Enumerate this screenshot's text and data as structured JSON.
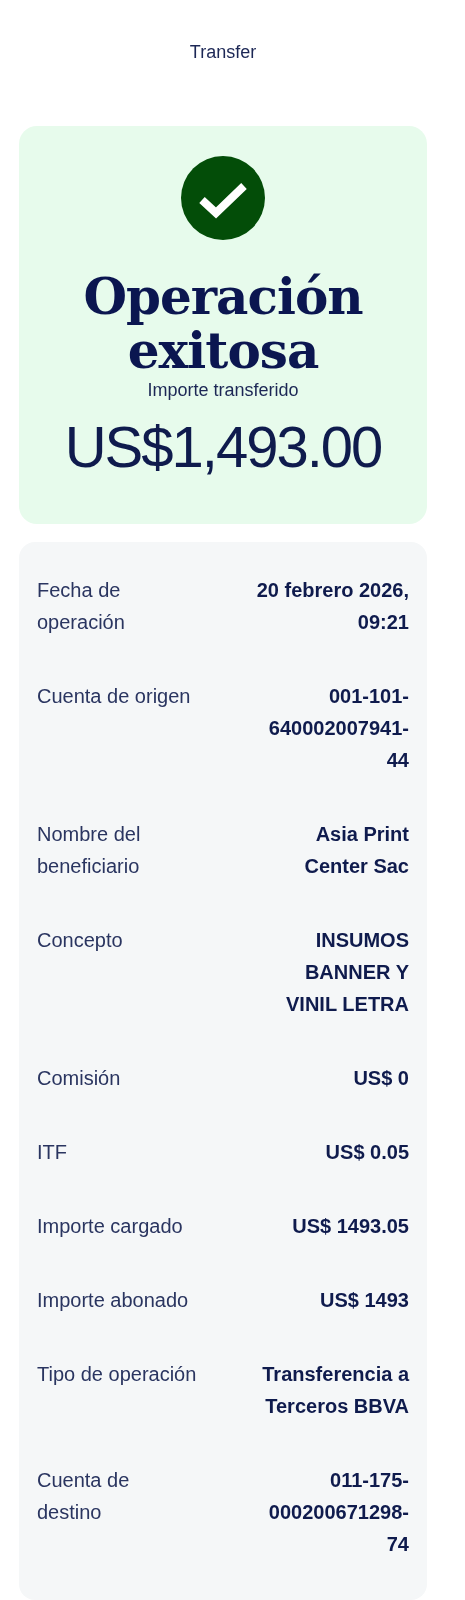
{
  "header": {
    "title": "Transfer"
  },
  "result": {
    "succeeded": true,
    "heading": "Operación exitosa",
    "amount_label": "Importe transferido",
    "amount": "US$1,493.00"
  },
  "details": [
    {
      "label": "Fecha de operación",
      "value": "20 febrero 2026, 09:21"
    },
    {
      "label": "Cuenta de origen",
      "value": "001-101-640002007941-44"
    },
    {
      "label": "Nombre del beneficiario",
      "value": "Asia Print Center Sac"
    },
    {
      "label": "Concepto",
      "value": "INSUMOS BANNER Y VINIL LETRA"
    },
    {
      "label": "Comisión",
      "value": "US$ 0"
    },
    {
      "label": "ITF",
      "value": "US$ 0.05"
    },
    {
      "label": "Importe cargado",
      "value": "US$ 1493.05"
    },
    {
      "label": "Importe abonado",
      "value": "US$ 1493"
    },
    {
      "label": "Tipo de operación",
      "value": "Transferencia a Terceros BBVA"
    },
    {
      "label": "Cuenta de destino",
      "value": "011-175-000200671298-74"
    }
  ]
}
